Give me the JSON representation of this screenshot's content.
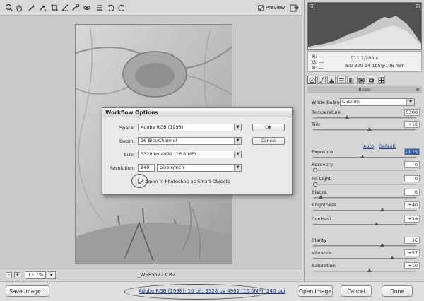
{
  "toolbar": {
    "tools": [
      "zoom-icon",
      "hand-icon",
      "white-balance-icon",
      "color-sampler-icon",
      "crop-icon",
      "straighten-icon",
      "spot-removal-icon",
      "red-eye-icon",
      "preferences-icon",
      "rotate-ccw-icon",
      "rotate-cw-icon"
    ],
    "preview_label": "Preview",
    "preview_checked": true
  },
  "status": {
    "zoom": "13.7%",
    "zoom_arrow": "▾",
    "minus": "-",
    "plus": "+",
    "filename": "_WSF5672.CR2"
  },
  "actions": {
    "save_image": "Save Image...",
    "workflow_link": "Adobe RGB (1998); 16 bit; 3328 by 4992 (16.6MP); 240 ppi",
    "open_image": "Open Image",
    "cancel": "Cancel",
    "done": "Done"
  },
  "readout": {
    "r": "R:   ---",
    "g": "G:   ---",
    "b": "B:   ---",
    "info1": "f/11   1/200 s",
    "info2": "ISO 800   24-105@105 mm"
  },
  "panel": {
    "section": "Basic",
    "menu": "≡",
    "white_balance_label": "White Balance:",
    "white_balance_value": "Custom",
    "auto": "Auto",
    "default": "Default",
    "sliders": [
      {
        "label": "Temperature",
        "value": "5300",
        "pos": 0.32
      },
      {
        "label": "Tint",
        "value": "+10",
        "pos": 0.55
      },
      {
        "label": "Exposure",
        "value": "-0.15",
        "pos": 0.48,
        "selected": true
      },
      {
        "label": "Recovery",
        "value": "0",
        "pos": 0.0
      },
      {
        "label": "Fill Light",
        "value": "0",
        "pos": 0.0
      },
      {
        "label": "Blacks",
        "value": "6",
        "pos": 0.06
      },
      {
        "label": "Brightness",
        "value": "+40",
        "pos": 0.68
      },
      {
        "label": "Contrast",
        "value": "+39",
        "pos": 0.62
      },
      {
        "label": "Clarity",
        "value": "36",
        "pos": 0.68
      },
      {
        "label": "Vibrance",
        "value": "+57",
        "pos": 0.78
      },
      {
        "label": "Saturation",
        "value": "+10",
        "pos": 0.55
      }
    ]
  },
  "dialog": {
    "title": "Workflow Options",
    "space_label": "Space:",
    "space_value": "Adobe RGB (1998)",
    "depth_label": "Depth:",
    "depth_value": "16 Bits/Channel",
    "size_label": "Size:",
    "size_value": "3328 by 4992 (16.6 MP)",
    "resolution_label": "Resolution:",
    "resolution_value": "240",
    "resolution_unit": "pixels/inch",
    "ok": "OK",
    "cancel": "Cancel",
    "smart_objects_label": "Open in Photoshop as Smart Objects",
    "smart_objects_checked": true
  }
}
